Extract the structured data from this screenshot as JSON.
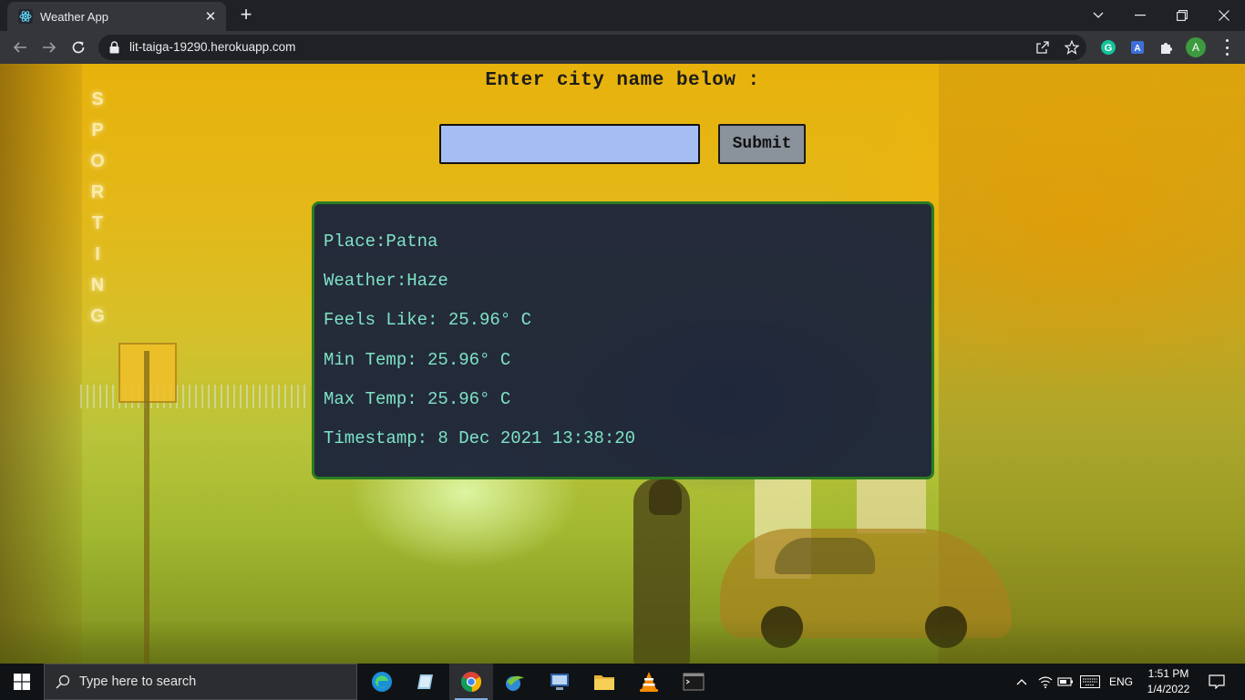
{
  "browser": {
    "tab_title": "Weather App",
    "tab_close": "✕",
    "new_tab": "+",
    "url": "lit-taiga-19290.herokuapp.com",
    "profile_initial": "A"
  },
  "app": {
    "heading": "Enter city name below :",
    "city_input_value": "",
    "submit_label": "Submit",
    "weather": {
      "place": "Place:Patna",
      "weather": "Weather:Haze",
      "feels_like": "Feels Like: 25.96° C",
      "min_temp": "Min Temp: 25.96° C",
      "max_temp": "Max Temp: 25.96° C",
      "timestamp": "Timestamp: 8 Dec 2021 13:38:20"
    },
    "background_sign_letters": [
      "S",
      "P",
      "O",
      "R",
      "T",
      "I",
      "N",
      "G"
    ]
  },
  "taskbar": {
    "search_placeholder": "Type here to search",
    "language": "ENG",
    "time": "1:51 PM",
    "date": "1/4/2022"
  },
  "colors": {
    "input_bg": "#a6bdf4",
    "button_bg": "#8a929c",
    "card_bg": "#1c243a",
    "card_border": "#2b7b22",
    "card_text": "#7ee3c6"
  }
}
